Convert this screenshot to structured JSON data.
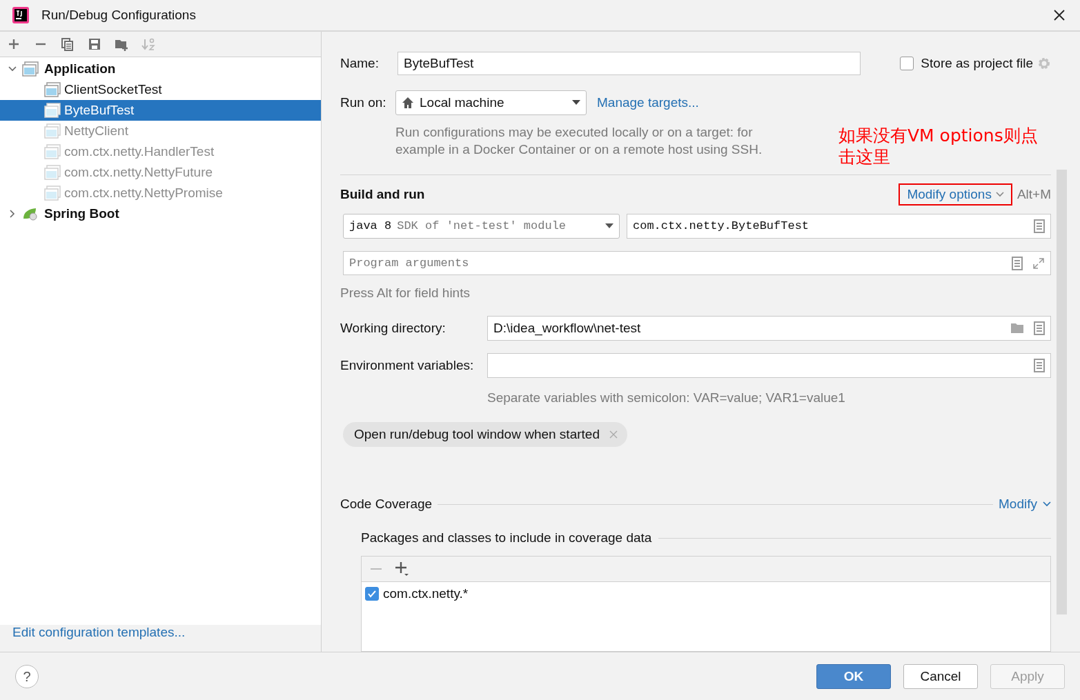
{
  "window": {
    "title": "Run/Debug Configurations"
  },
  "toolbar": [
    {
      "kind": "add",
      "disabled": false
    },
    {
      "kind": "remove",
      "disabled": false
    },
    {
      "kind": "copy",
      "disabled": false
    },
    {
      "kind": "save",
      "disabled": false
    },
    {
      "kind": "folder",
      "disabled": false
    },
    {
      "kind": "sort",
      "disabled": true
    }
  ],
  "tree": [
    {
      "label": "Application",
      "kind": "application",
      "expanded": true,
      "children": [
        {
          "label": "ClientSocketTest",
          "selected": false,
          "temporary": false
        },
        {
          "label": "ByteBufTest",
          "selected": true,
          "temporary": false
        },
        {
          "label": "NettyClient",
          "selected": false,
          "temporary": true
        },
        {
          "label": "com.ctx.netty.HandlerTest",
          "selected": false,
          "temporary": true
        },
        {
          "label": "com.ctx.netty.NettyFuture",
          "selected": false,
          "temporary": true
        },
        {
          "label": "com.ctx.netty.NettyPromise",
          "selected": false,
          "temporary": true
        }
      ]
    },
    {
      "label": "Spring Boot",
      "kind": "spring",
      "expanded": false
    }
  ],
  "edit_templates_link": "Edit configuration templates...",
  "form": {
    "name_label": "Name:",
    "name_value": "ByteBufTest",
    "store_as_project_file": {
      "label": "Store as project file",
      "checked": false
    },
    "run_on_label": "Run on:",
    "run_on_value": "Local machine",
    "manage_targets": "Manage targets...",
    "run_on_hint": "Run configurations may be executed locally or on a target: for example in a Docker Container or on a remote host using SSH.",
    "annotation": "如果没有VM options则点击这里"
  },
  "build_and_run": {
    "title": "Build and run",
    "modify_options": "Modify options",
    "shortcut": "Alt+M",
    "jre": {
      "value": "java 8",
      "hint": "SDK of 'net-test' module"
    },
    "main_class": "com.ctx.netty.ByteBufTest",
    "program_arguments": {
      "placeholder": "Program arguments"
    },
    "field_hints": "Press Alt for field hints",
    "working_directory_label": "Working directory:",
    "working_directory_value": "D:\\idea_workflow\\net-test",
    "environment_variables_label": "Environment variables:",
    "environment_hint": "Separate variables with semicolon: VAR=value; VAR1=value1",
    "option_tags": [
      {
        "label": "Open run/debug tool window when started"
      }
    ]
  },
  "code_coverage": {
    "title": "Code Coverage",
    "modify": "Modify",
    "packages_label": "Packages and classes to include in coverage data",
    "packages": [
      {
        "pattern": "com.ctx.netty.*",
        "checked": true
      }
    ]
  },
  "help_button": "?",
  "buttons": [
    {
      "label": "OK",
      "kind": "primary",
      "disabled": false
    },
    {
      "label": "Cancel",
      "kind": "normal",
      "disabled": false
    },
    {
      "label": "Apply",
      "kind": "normal",
      "disabled": true
    }
  ]
}
